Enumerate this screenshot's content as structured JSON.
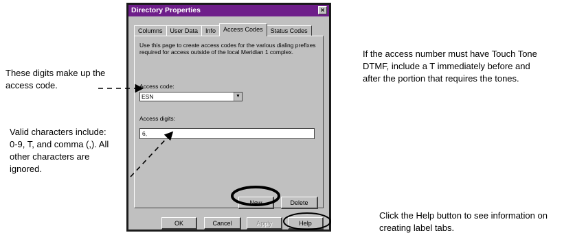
{
  "dialog": {
    "title": "Directory Properties",
    "close_label": "×",
    "tabs": [
      {
        "label": "Columns"
      },
      {
        "label": "User Data"
      },
      {
        "label": "Info"
      },
      {
        "label": "Access Codes",
        "active": true
      },
      {
        "label": "Status Codes"
      }
    ],
    "description_line1": "Use this page to create access codes for the various dialing prefixes",
    "description_line2": "required for access outside of the local Meridian 1 complex.",
    "access_code_label": "Access code:",
    "access_code_value": "ESN",
    "access_digits_label": "Access digits:",
    "access_digits_value": "6,",
    "new_button": "New",
    "delete_button": "Delete",
    "ok_button": "OK",
    "cancel_button": "Cancel",
    "apply_button": "Apply",
    "help_button": "Help"
  },
  "annotations": {
    "digits_line1": "These digits make up the",
    "digits_line2": "access code.",
    "valid_line1": "Valid characters include:",
    "valid_line2": "0-9, T, and comma (,). All",
    "valid_line3": "other characters are",
    "valid_line4": "ignored.",
    "dtmf_line1": "If the access number must have Touch Tone",
    "dtmf_line2": "DTMF, include a T immediately before and",
    "dtmf_line3": "after the portion that requires the tones.",
    "help_line1": "Click the Help button to see information on",
    "help_line2": "creating label tabs."
  },
  "colors": {
    "title_bar": "#6e1e8a",
    "dialog_face": "#c0c0c0",
    "highlight_ellipse": "#000000"
  }
}
